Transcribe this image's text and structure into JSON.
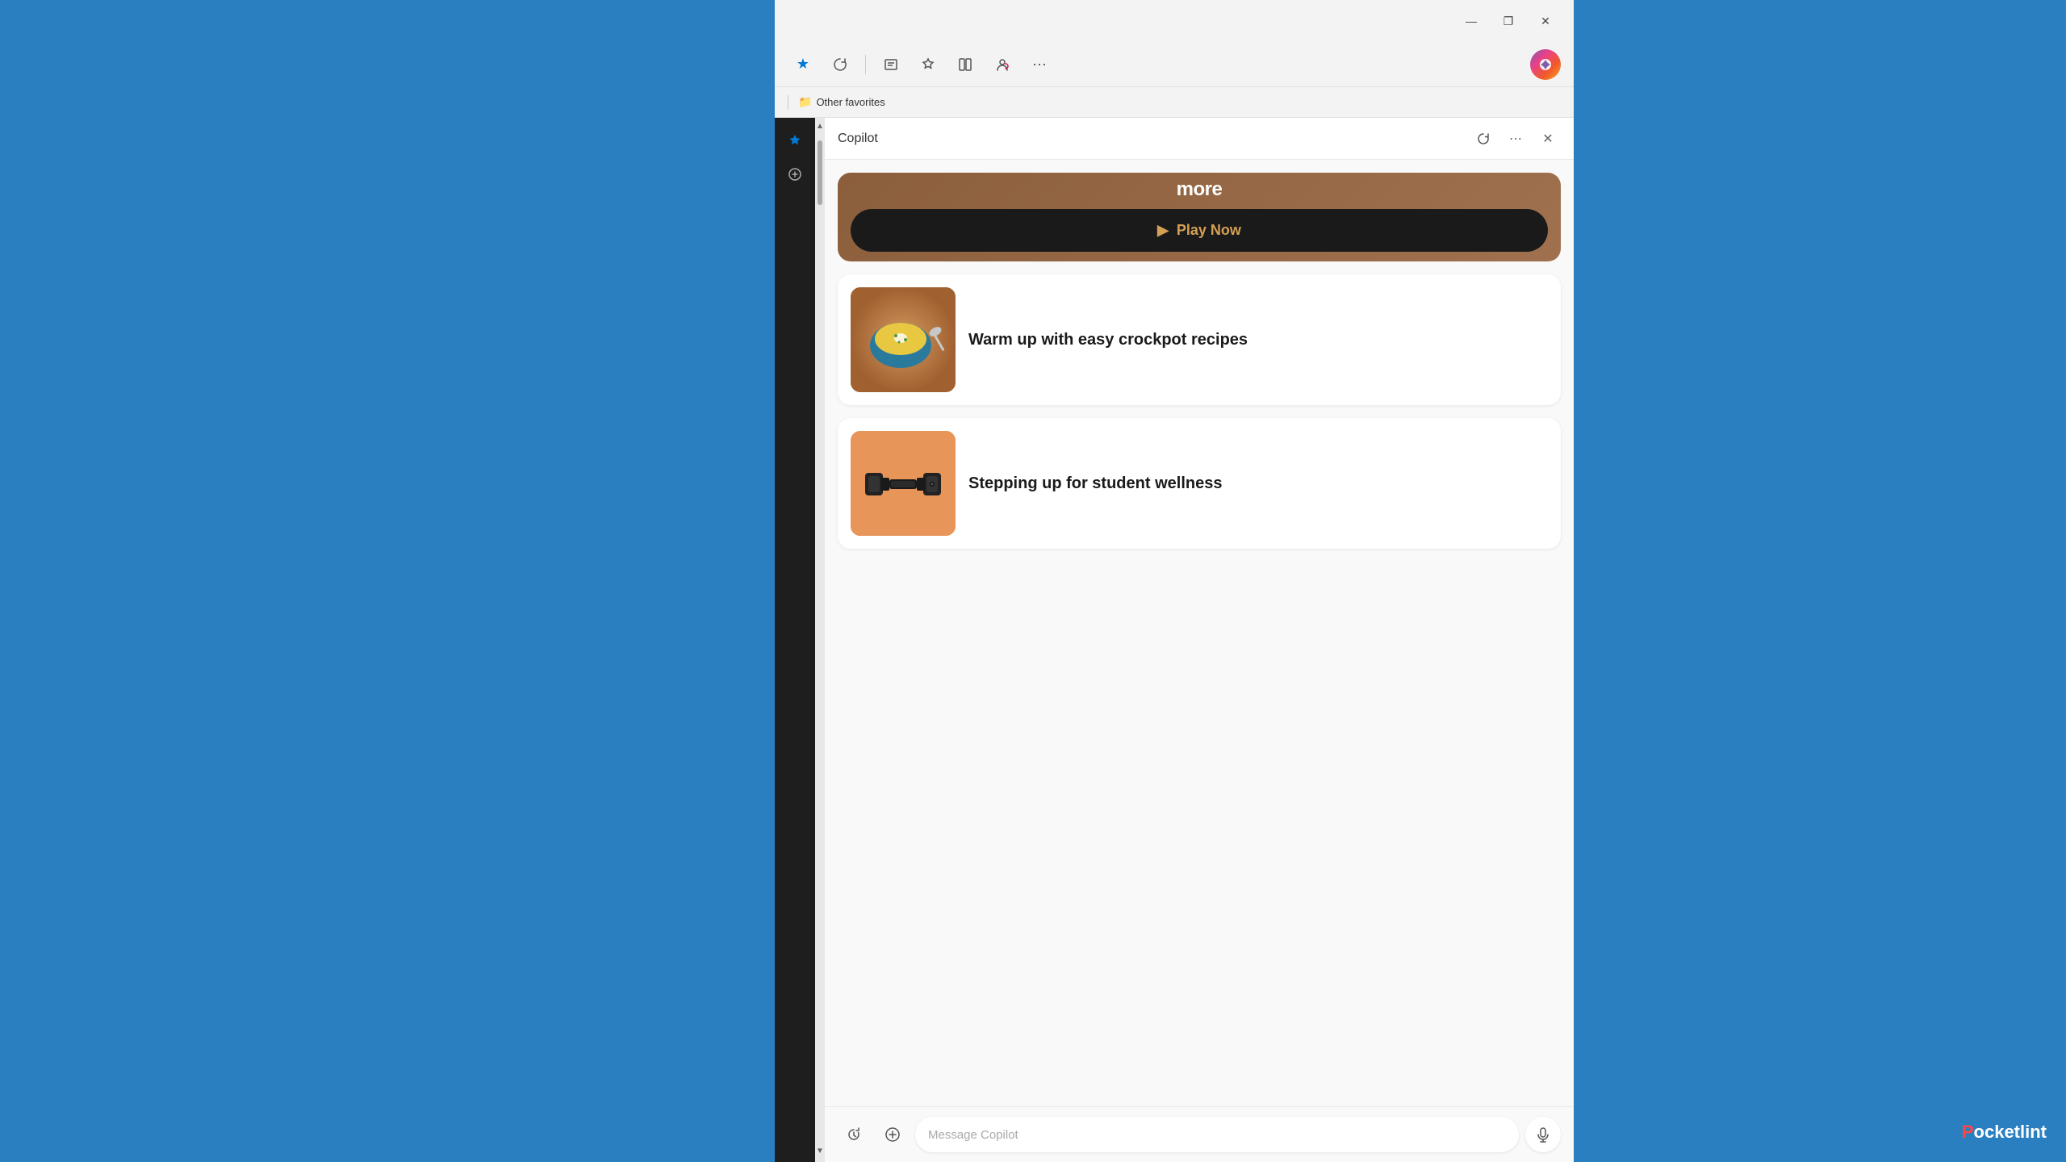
{
  "window": {
    "title": "Copilot",
    "controls": {
      "minimize": "—",
      "maximize": "❐",
      "close": "✕"
    }
  },
  "toolbar": {
    "favorites_btn": "★",
    "refresh_btn": "↻",
    "reader_btn": "☰",
    "collections_btn": "☆",
    "split_btn": "⊞",
    "family_btn": "♥",
    "more_btn": "···",
    "copilot_btn": "✦",
    "other_favorites_label": "Other favorites"
  },
  "copilot": {
    "title": "Copilot",
    "refresh_icon": "↻",
    "more_icon": "⋯",
    "close_icon": "✕"
  },
  "play_now_card": {
    "partial_title": "more",
    "button_label": "Play Now"
  },
  "cards": [
    {
      "id": "crockpot",
      "title": "Warm up with easy crockpot recipes",
      "image_type": "soup"
    },
    {
      "id": "wellness",
      "title": "Stepping up for student wellness",
      "image_type": "dumbbell"
    }
  ],
  "message_bar": {
    "history_icon": "↺",
    "add_icon": "+",
    "placeholder": "Message Copilot",
    "mic_icon": "🎤"
  },
  "pocketlint": {
    "brand": "Pocketlint"
  }
}
